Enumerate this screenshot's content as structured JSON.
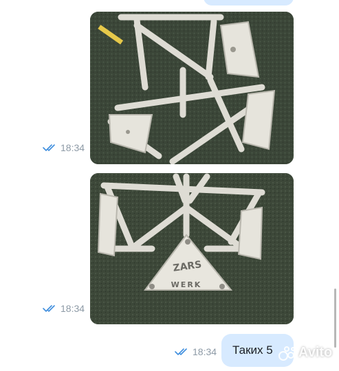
{
  "messages": [
    {
      "type": "photo",
      "time": "18:34",
      "status": "read-double-check"
    },
    {
      "type": "photo",
      "time": "18:34",
      "status": "read-double-check"
    },
    {
      "type": "text",
      "text": "Таких 5",
      "time": "18:34",
      "status": "read-double-check"
    }
  ],
  "photo2": {
    "stencil_top": "ZARS",
    "stencil_bottom": "WERK"
  },
  "watermark": {
    "text": "Avito"
  },
  "colors": {
    "outgoing_bubble": "#d7eaff",
    "check_mark": "#3e8ede",
    "meta_text": "#8d9aa6",
    "grass": "#3e4a3a",
    "metal": "#dcdad2"
  }
}
